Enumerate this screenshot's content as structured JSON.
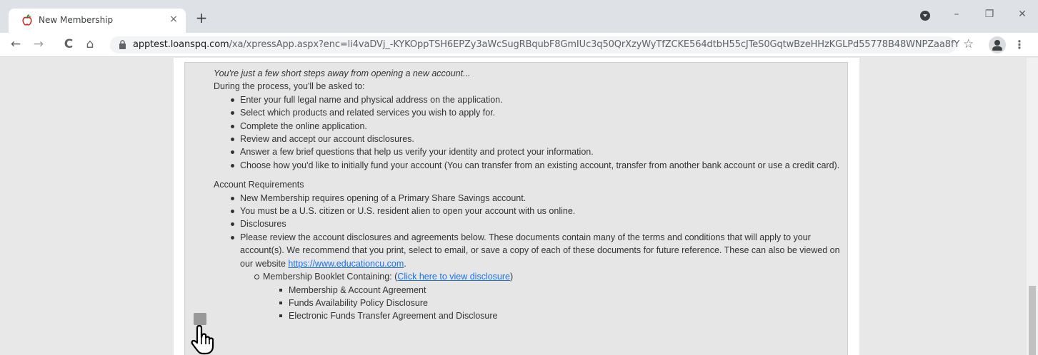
{
  "browser": {
    "tab_title": "New Membership",
    "tab_close": "×",
    "new_tab": "+",
    "url_host": "apptest.loanspq.com",
    "url_path": "/xa/xpressApp.aspx?enc=li4vaDVj_-KYKOppTSH6EPZy3aWcSugRBqubF8GmIUc3q50QrXzyWyTfZCKE564dtbH55cJTeS0GqtwBzeHHzKGLPd55778B48WNPZaa8fY",
    "icons": {
      "back": "←",
      "forward": "→",
      "reload": "C",
      "home": "⌂",
      "star": "☆",
      "menu": "⋮",
      "minimize": "–",
      "maximize": "❐",
      "close": "✕"
    }
  },
  "content": {
    "intro": "You're just a few short steps away from opening a new account...",
    "process_heading": "During the process, you'll be asked to:",
    "process_steps": [
      "Enter your full legal name and physical address on the application.",
      "Select which products and related services you wish to apply for.",
      "Complete the online application.",
      "Review and accept our account disclosures.",
      "Answer a few brief questions that help us verify your identity and protect your information.",
      "Choose how you'd like to initially fund your account (You can transfer from an existing account, transfer from another bank account or use a credit card)."
    ],
    "requirements_heading": "Account Requirements",
    "requirements": [
      "New Membership requires opening of a Primary Share Savings account.",
      "You must be a U.S. citizen or U.S. resident alien to open your account with us online.",
      "Disclosures"
    ],
    "review_text": "Please review the account disclosures and agreements below. These documents contain many of the terms and conditions that will apply to your account(s). We recommend that you print, select to email, or save a copy of each of these documents for future reference. These can also be viewed on our website ",
    "website_link": "https://www.educationcu.com",
    "review_end": ".",
    "booklet_prefix": "Membership Booklet Containing: (",
    "booklet_link": "Click here to view disclosure",
    "booklet_suffix": ")",
    "booklet_items": [
      "Membership & Account Agreement",
      "Funds Availability Policy Disclosure",
      "Electronic Funds Transfer Agreement and Disclosure"
    ]
  }
}
